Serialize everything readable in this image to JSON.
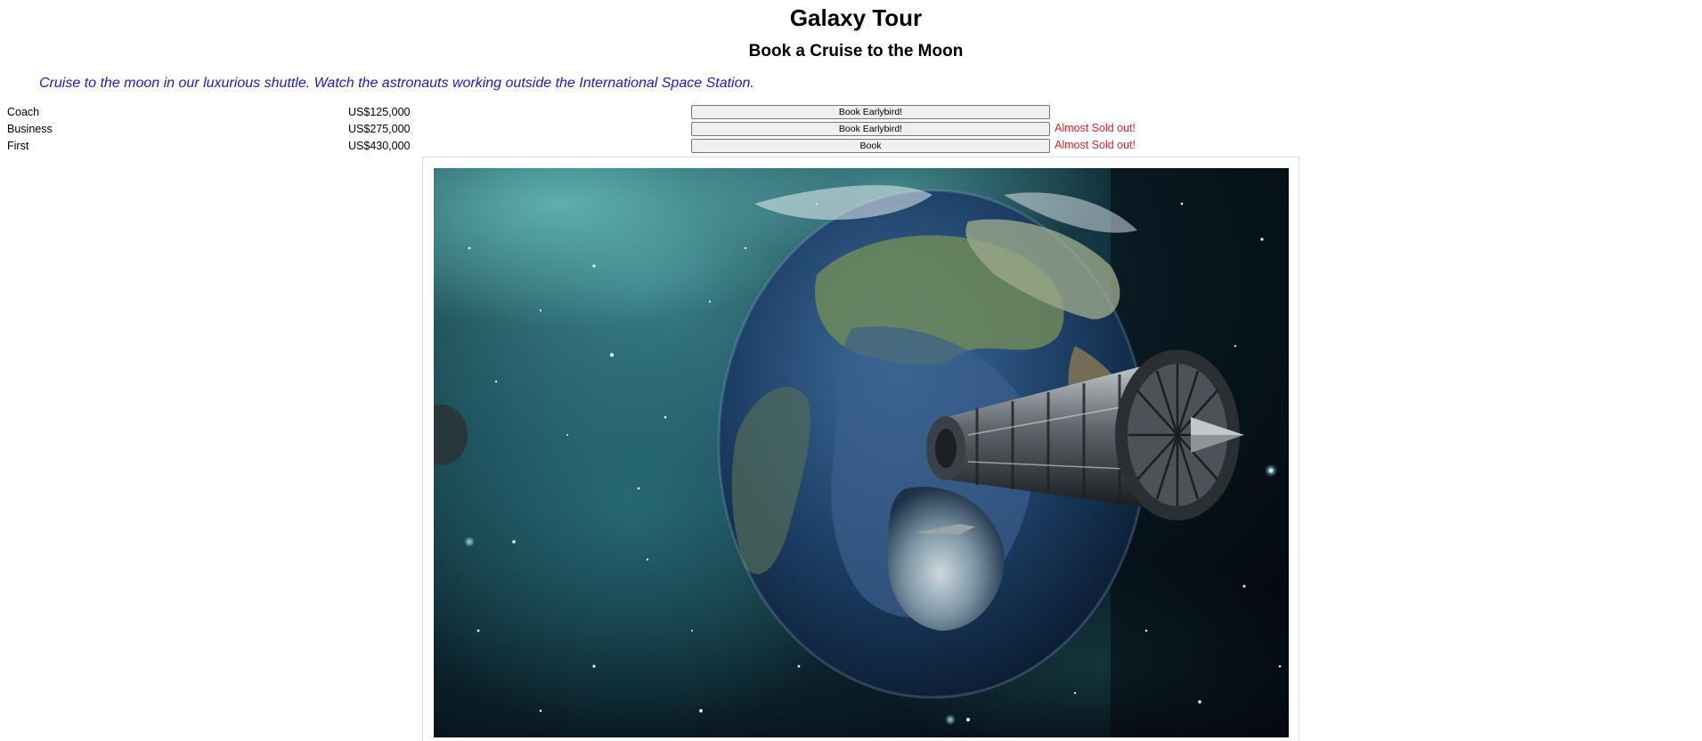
{
  "header": {
    "title": "Galaxy Tour",
    "subtitle": "Book a Cruise to the Moon"
  },
  "intro": {
    "text": "Cruise to the moon in our luxurious shuttle. Watch the astronauts working outside the International Space Station.",
    "color": "#1a1ad6"
  },
  "fares": [
    {
      "class": "Coach",
      "price": "US$125,000",
      "button": "Book Earlybird!",
      "status": ""
    },
    {
      "class": "Business",
      "price": "US$275,000",
      "button": "Book Earlybird!",
      "status": "Almost Sold out!"
    },
    {
      "class": "First",
      "price": "US$430,000",
      "button": "Book",
      "status": "Almost Sold out!"
    }
  ],
  "colors": {
    "status": "#e8202a",
    "space_dark": "#07141a",
    "nebula": "#3f9a9c"
  },
  "image": {
    "subject": "Earth with spaceship in space illustration"
  }
}
